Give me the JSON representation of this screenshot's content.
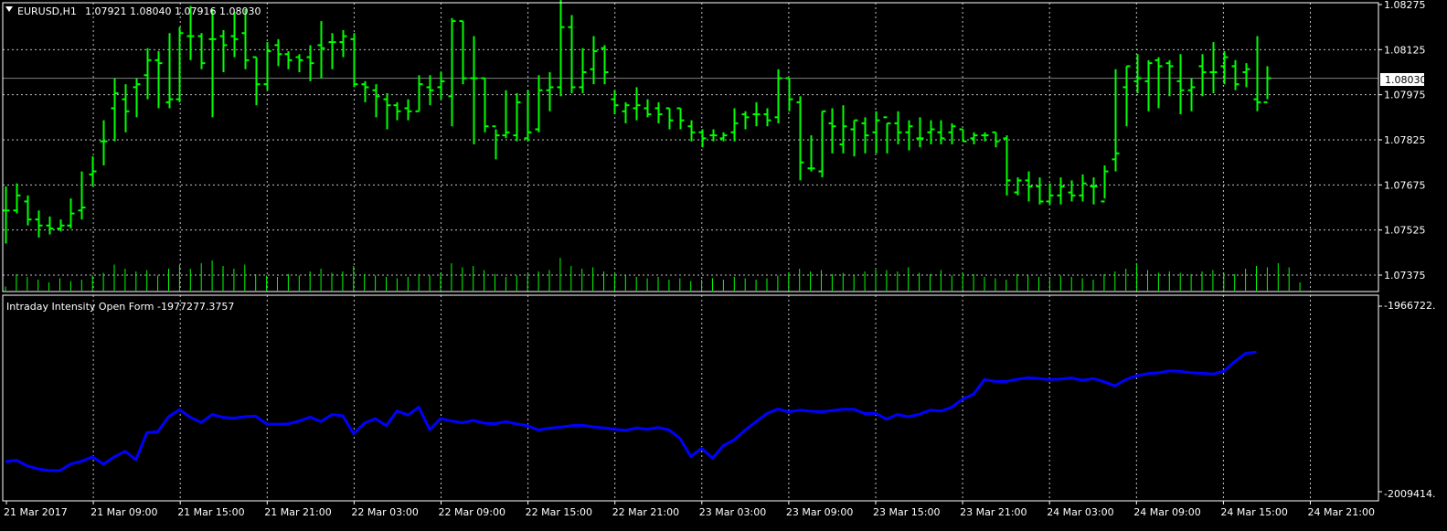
{
  "colors": {
    "background": "#000000",
    "grid": "#c0c0c0",
    "bar_up": "#00ff00",
    "bar_down": "#00ff00",
    "volume": "#00ff00",
    "indicator_line": "#0000ff",
    "text": "#ffffff",
    "current_price_line": "#808080"
  },
  "header": {
    "symbol_label": "EURUSD,H1",
    "ohlc": "1.07921 1.08040 1.07916 1.08030",
    "collapse_icon": "triangle-down-icon"
  },
  "current_price_tag": "1.08030",
  "indicator": {
    "label": "Intraday Intensity Open Form -1977277.3757",
    "axis_top": "-1966722.",
    "axis_bottom": "-2009414."
  },
  "price_axis_labels": [
    "1.08275",
    "1.08125",
    "1.07975",
    "1.07825",
    "1.07675",
    "1.07525",
    "1.07375"
  ],
  "time_labels": [
    "21 Mar 2017",
    "21 Mar 09:00",
    "21 Mar 15:00",
    "21 Mar 21:00",
    "22 Mar 03:00",
    "22 Mar 09:00",
    "22 Mar 15:00",
    "22 Mar 21:00",
    "23 Mar 03:00",
    "23 Mar 09:00",
    "23 Mar 15:00",
    "23 Mar 21:00",
    "24 Mar 03:00",
    "24 Mar 09:00",
    "24 Mar 15:00",
    "24 Mar 21:00"
  ],
  "chart_data": [
    {
      "type": "ohlc",
      "symbol": "EURUSD",
      "timeframe": "H1",
      "price_range": [
        1.0732,
        1.0829
      ],
      "current_price": 1.0803,
      "bars": [
        [
          1.0759,
          1.0767,
          1.0748,
          1.0759
        ],
        [
          1.0759,
          1.0768,
          1.0758,
          1.0764
        ],
        [
          1.0762,
          1.0764,
          1.0754,
          1.0756
        ],
        [
          1.0756,
          1.0759,
          1.075,
          1.0754
        ],
        [
          1.0754,
          1.0757,
          1.0751,
          1.0753
        ],
        [
          1.0753,
          1.0756,
          1.0752,
          1.0754
        ],
        [
          1.0754,
          1.0763,
          1.0753,
          1.0758
        ],
        [
          1.0759,
          1.0772,
          1.0756,
          1.076
        ],
        [
          1.0771,
          1.0777,
          1.0767,
          1.0772
        ],
        [
          1.0782,
          1.0789,
          1.0774,
          1.0782
        ],
        [
          1.0793,
          1.0803,
          1.0782,
          1.0798
        ],
        [
          1.0796,
          1.0801,
          1.0785,
          1.0792
        ],
        [
          1.08,
          1.0803,
          1.079,
          1.0801
        ],
        [
          1.0804,
          1.0813,
          1.0796,
          1.0809
        ],
        [
          1.0809,
          1.0812,
          1.0793,
          1.0808
        ],
        [
          1.0795,
          1.0818,
          1.0793,
          1.0796
        ],
        [
          1.0796,
          1.082,
          1.0795,
          1.0818
        ],
        [
          1.0817,
          1.0827,
          1.0809,
          1.0817
        ],
        [
          1.0817,
          1.0818,
          1.0806,
          1.0808
        ],
        [
          1.0816,
          1.0826,
          1.079,
          1.0816
        ],
        [
          1.0817,
          1.0819,
          1.0805,
          1.0814
        ],
        [
          1.0817,
          1.0825,
          1.081,
          1.0816
        ],
        [
          1.0818,
          1.0826,
          1.0806,
          1.0809
        ],
        [
          1.081,
          1.081,
          1.0794,
          1.0801
        ],
        [
          1.0801,
          1.0815,
          1.0799,
          1.0812
        ],
        [
          1.0814,
          1.0816,
          1.0807,
          1.0811
        ],
        [
          1.0811,
          1.0812,
          1.0806,
          1.0809
        ],
        [
          1.081,
          1.0811,
          1.0805,
          1.0809
        ],
        [
          1.081,
          1.0814,
          1.0802,
          1.0808
        ],
        [
          1.0814,
          1.0822,
          1.0803,
          1.0813
        ],
        [
          1.0815,
          1.0818,
          1.0806,
          1.0815
        ],
        [
          1.0815,
          1.0819,
          1.081,
          1.0817
        ],
        [
          1.0816,
          1.0818,
          1.08,
          1.0801
        ],
        [
          1.0801,
          1.0802,
          1.0795,
          1.08
        ],
        [
          1.0799,
          1.0801,
          1.079,
          1.0797
        ],
        [
          1.0796,
          1.0798,
          1.0786,
          1.0794
        ],
        [
          1.0794,
          1.0795,
          1.0789,
          1.0792
        ],
        [
          1.0793,
          1.0796,
          1.0789,
          1.0792
        ],
        [
          1.0792,
          1.0804,
          1.0792,
          1.0801
        ],
        [
          1.08,
          1.0804,
          1.0794,
          1.0799
        ],
        [
          1.08,
          1.0805,
          1.0796,
          1.0802
        ],
        [
          1.0797,
          1.0823,
          1.0787,
          1.0822
        ],
        [
          1.0822,
          1.0822,
          1.0801,
          1.0803
        ],
        [
          1.0803,
          1.0817,
          1.0781,
          1.0803
        ],
        [
          1.0803,
          1.0803,
          1.0785,
          1.0787
        ],
        [
          1.0787,
          1.0786,
          1.0776,
          1.0784
        ],
        [
          1.0784,
          1.0799,
          1.0783,
          1.0785
        ],
        [
          1.0784,
          1.0798,
          1.0782,
          1.0795
        ],
        [
          1.0783,
          1.0799,
          1.0782,
          1.0785
        ],
        [
          1.0786,
          1.0804,
          1.0785,
          1.0799
        ],
        [
          1.0799,
          1.0805,
          1.0792,
          1.08
        ],
        [
          1.08,
          1.0829,
          1.0797,
          1.082
        ],
        [
          1.082,
          1.0824,
          1.0798,
          1.08
        ],
        [
          1.08,
          1.0813,
          1.0798,
          1.0805
        ],
        [
          1.0806,
          1.0817,
          1.0801,
          1.0812
        ],
        [
          1.0813,
          1.0814,
          1.0801,
          1.0805
        ],
        [
          1.0796,
          1.0799,
          1.0791,
          1.0794
        ],
        [
          1.0792,
          1.0795,
          1.0788,
          1.0794
        ],
        [
          1.0793,
          1.08,
          1.0789,
          1.0794
        ],
        [
          1.0793,
          1.0796,
          1.079,
          1.0791
        ],
        [
          1.0793,
          1.0795,
          1.0788,
          1.0791
        ],
        [
          1.0793,
          1.0793,
          1.0786,
          1.0789
        ],
        [
          1.0793,
          1.0793,
          1.0786,
          1.0789
        ],
        [
          1.0787,
          1.0789,
          1.0782,
          1.0785
        ],
        [
          1.0785,
          1.0786,
          1.078,
          1.0783
        ],
        [
          1.0784,
          1.0786,
          1.0782,
          1.0784
        ],
        [
          1.0783,
          1.0785,
          1.0782,
          1.0784
        ],
        [
          1.0785,
          1.0793,
          1.0782,
          1.0788
        ],
        [
          1.0791,
          1.0792,
          1.0786,
          1.079
        ],
        [
          1.0791,
          1.0795,
          1.0787,
          1.0791
        ],
        [
          1.0791,
          1.0793,
          1.0787,
          1.0789
        ],
        [
          1.079,
          1.0806,
          1.0788,
          1.0803
        ],
        [
          1.0803,
          1.0803,
          1.0792,
          1.0796
        ],
        [
          1.0795,
          1.0797,
          1.0769,
          1.0775
        ],
        [
          1.0773,
          1.0784,
          1.0772,
          1.0773
        ],
        [
          1.0772,
          1.0792,
          1.077,
          1.0792
        ],
        [
          1.0788,
          1.0793,
          1.0778,
          1.0787
        ],
        [
          1.0781,
          1.0794,
          1.0778,
          1.0787
        ],
        [
          1.0786,
          1.0789,
          1.0777,
          1.0789
        ],
        [
          1.0788,
          1.079,
          1.0778,
          1.0784
        ],
        [
          1.0785,
          1.0792,
          1.0778,
          1.0789
        ],
        [
          1.079,
          1.0788,
          1.0778,
          1.0788
        ],
        [
          1.0788,
          1.0792,
          1.0781,
          1.0785
        ],
        [
          1.0785,
          1.0789,
          1.0779,
          1.0787
        ],
        [
          1.0783,
          1.079,
          1.078,
          1.0783
        ],
        [
          1.0785,
          1.0789,
          1.0781,
          1.0786
        ],
        [
          1.0785,
          1.0789,
          1.0781,
          1.0783
        ],
        [
          1.0785,
          1.0788,
          1.0781,
          1.0787
        ],
        [
          1.0786,
          1.0786,
          1.0782,
          1.0782
        ],
        [
          1.0783,
          1.0785,
          1.0781,
          1.0784
        ],
        [
          1.0784,
          1.0785,
          1.0782,
          1.0784
        ],
        [
          1.0785,
          1.0785,
          1.078,
          1.0782
        ],
        [
          1.0783,
          1.0784,
          1.0764,
          1.0769
        ],
        [
          1.0765,
          1.077,
          1.0764,
          1.0769
        ],
        [
          1.0769,
          1.0772,
          1.0762,
          1.0767
        ],
        [
          1.0767,
          1.077,
          1.0761,
          1.0762
        ],
        [
          1.0762,
          1.0768,
          1.0761,
          1.0764
        ],
        [
          1.0764,
          1.077,
          1.0761,
          1.0767
        ],
        [
          1.0765,
          1.0769,
          1.0762,
          1.0764
        ],
        [
          1.0764,
          1.0771,
          1.0762,
          1.0768
        ],
        [
          1.0767,
          1.077,
          1.0761,
          1.0767
        ],
        [
          1.0762,
          1.0774,
          1.0763,
          1.0772
        ],
        [
          1.0776,
          1.0806,
          1.0772,
          1.0778
        ],
        [
          1.08,
          1.0807,
          1.0787,
          1.0807
        ],
        [
          1.0802,
          1.0811,
          1.0798,
          1.0803
        ],
        [
          1.0802,
          1.0809,
          1.0792,
          1.0808
        ],
        [
          1.0809,
          1.081,
          1.0793,
          1.0807
        ],
        [
          1.0808,
          1.0809,
          1.0797,
          1.0807
        ],
        [
          1.0802,
          1.0811,
          1.0791,
          1.0799
        ],
        [
          1.0799,
          1.0803,
          1.0792,
          1.08
        ],
        [
          1.0807,
          1.0811,
          1.0797,
          1.0805
        ],
        [
          1.0805,
          1.0815,
          1.0798,
          1.0805
        ],
        [
          1.0807,
          1.0812,
          1.0801,
          1.081
        ],
        [
          1.0807,
          1.0809,
          1.0799,
          1.0801
        ],
        [
          1.0805,
          1.0808,
          1.08,
          1.0806
        ],
        [
          1.0796,
          1.0817,
          1.0792,
          1.0795
        ],
        [
          1.0795,
          1.0807,
          1.0796,
          1.0803
        ]
      ],
      "volume": [
        3,
        12,
        10,
        8,
        6,
        9,
        7,
        8,
        11,
        13,
        19,
        16,
        14,
        15,
        11,
        16,
        19,
        16,
        20,
        22,
        18,
        16,
        19,
        12,
        11,
        10,
        12,
        11,
        14,
        16,
        13,
        14,
        18,
        12,
        11,
        10,
        9,
        10,
        12,
        11,
        13,
        20,
        17,
        18,
        15,
        12,
        10,
        11,
        12,
        14,
        15,
        24,
        18,
        16,
        17,
        14,
        12,
        11,
        10,
        9,
        10,
        8,
        9,
        7,
        8,
        9,
        8,
        10,
        9,
        8,
        9,
        11,
        13,
        16,
        14,
        15,
        12,
        13,
        11,
        14,
        16,
        15,
        14,
        17,
        13,
        12,
        15,
        11,
        13,
        12,
        10,
        9,
        8,
        12,
        11,
        10,
        9,
        11,
        10,
        9,
        8,
        12,
        14,
        16,
        20,
        15,
        13,
        14,
        13,
        12,
        14,
        15,
        13,
        12,
        16,
        18,
        17,
        20,
        17,
        6
      ]
    },
    {
      "type": "line",
      "name": "Intraday Intensity Open Form",
      "value_range": [
        -2009414,
        -1966722
      ],
      "last_value": -1977277.3757,
      "values": [
        -2002470,
        -2002180,
        -2003470,
        -2004180,
        -2004560,
        -2004560,
        -2003050,
        -2002420,
        -2001400,
        -2003060,
        -2001400,
        -2000120,
        -2002060,
        -1995830,
        -1995610,
        -1992150,
        -1990530,
        -1992290,
        -1993500,
        -1991670,
        -1992290,
        -1992510,
        -1992150,
        -1992030,
        -1993820,
        -1993920,
        -1993780,
        -1993160,
        -1992250,
        -1993280,
        -1991670,
        -1991930,
        -1996090,
        -1993650,
        -1992580,
        -1994230,
        -1990830,
        -1991780,
        -1989960,
        -1995160,
        -1992580,
        -1993150,
        -1993560,
        -1993000,
        -1993650,
        -1993780,
        -1993280,
        -1993820,
        -1994230,
        -1995220,
        -1994800,
        -1994560,
        -1994230,
        -1994130,
        -1994490,
        -1994740,
        -1995020,
        -1995310,
        -1994750,
        -1995030,
        -1994620,
        -1995190,
        -1997130,
        -2001310,
        -1999400,
        -2001720,
        -1998790,
        -1997470,
        -1995240,
        -1993290,
        -1991430,
        -1990380,
        -1991050,
        -1990650,
        -1990880,
        -1991030,
        -1990770,
        -1990440,
        -1990450,
        -1991460,
        -1991390,
        -1992710,
        -1991650,
        -1992170,
        -1991630,
        -1990650,
        -1990870,
        -1989970,
        -1988090,
        -1986950,
        -1983620,
        -1984050,
        -1984060,
        -1983540,
        -1983190,
        -1983400,
        -1983580,
        -1983490,
        -1983230,
        -1983770,
        -1983380,
        -1984110,
        -1985060,
        -1983620,
        -1982730,
        -1982250,
        -1982080,
        -1981610,
        -1981720,
        -1982060,
        -1982150,
        -1982370,
        -1981680,
        -1979510,
        -1977600,
        -1977277
      ]
    }
  ]
}
